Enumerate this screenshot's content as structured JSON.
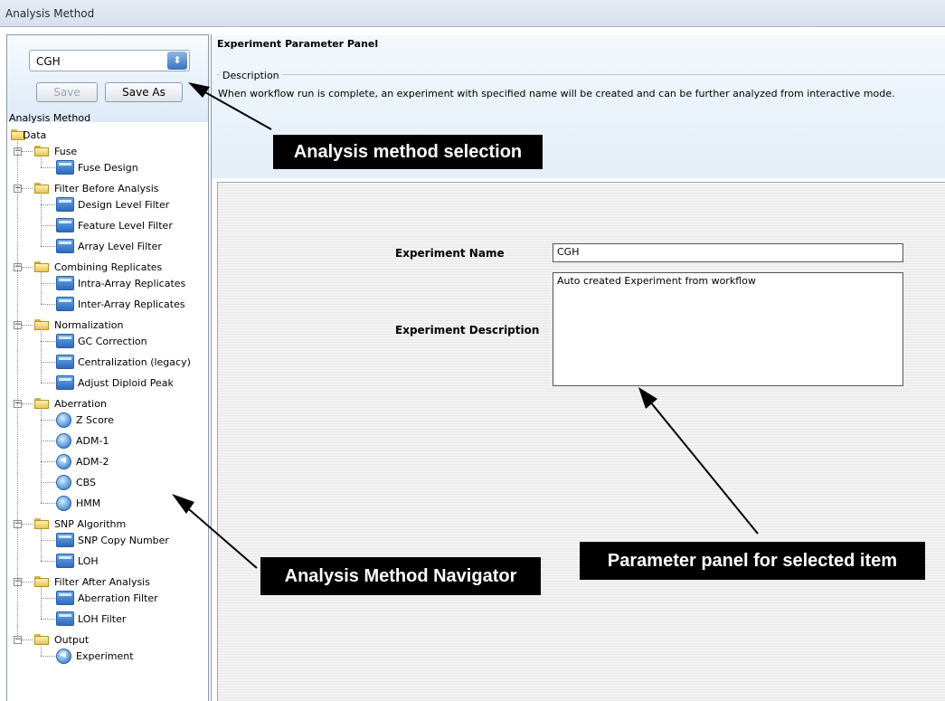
{
  "window": {
    "title": "Analysis Method"
  },
  "left": {
    "combo_value": "CGH",
    "save_label": "Save",
    "save_as_label": "Save As",
    "section_label": "Analysis Method",
    "tree": {
      "root": "Data",
      "groups": [
        {
          "label": "Fuse",
          "items": [
            {
              "label": "Fuse Design",
              "icon": "doc"
            }
          ]
        },
        {
          "label": "Filter Before Analysis",
          "items": [
            {
              "label": "Design Level Filter",
              "icon": "doc"
            },
            {
              "label": "Feature Level Filter",
              "icon": "doc"
            },
            {
              "label": "Array Level Filter",
              "icon": "doc"
            }
          ]
        },
        {
          "label": "Combining Replicates",
          "items": [
            {
              "label": "Intra-Array Replicates",
              "icon": "doc"
            },
            {
              "label": "Inter-Array Replicates",
              "icon": "doc"
            }
          ]
        },
        {
          "label": "Normalization",
          "items": [
            {
              "label": "GC Correction",
              "icon": "doc"
            },
            {
              "label": "Centralization (legacy)",
              "icon": "doc"
            },
            {
              "label": "Adjust Diploid Peak",
              "icon": "doc"
            }
          ]
        },
        {
          "label": "Aberration",
          "items": [
            {
              "label": "Z Score",
              "icon": "radio"
            },
            {
              "label": "ADM-1",
              "icon": "radio"
            },
            {
              "label": "ADM-2",
              "icon": "radio-selected"
            },
            {
              "label": "CBS",
              "icon": "radio"
            },
            {
              "label": "HMM",
              "icon": "radio"
            }
          ]
        },
        {
          "label": "SNP Algorithm",
          "items": [
            {
              "label": "SNP Copy Number",
              "icon": "doc"
            },
            {
              "label": "LOH",
              "icon": "doc"
            }
          ]
        },
        {
          "label": "Filter After Analysis",
          "items": [
            {
              "label": "Aberration Filter",
              "icon": "doc"
            },
            {
              "label": "LOH Filter",
              "icon": "doc"
            }
          ]
        },
        {
          "label": "Output",
          "items": [
            {
              "label": "Experiment",
              "icon": "radio-selected"
            }
          ]
        }
      ]
    }
  },
  "panel": {
    "title": "Experiment Parameter Panel",
    "description_legend": "Description",
    "description_text": "When workflow run is complete, an experiment with specified name will be created and can be further analyzed from interactive mode.",
    "experiment_name_label": "Experiment Name",
    "experiment_name_value": "CGH",
    "experiment_description_label": "Experiment Description",
    "experiment_description_value": "Auto created Experiment from workflow"
  },
  "callouts": {
    "analysis_method_selection": "Analysis method selection",
    "analysis_method_navigator": "Analysis Method Navigator",
    "parameter_panel": "Parameter panel for selected item"
  }
}
